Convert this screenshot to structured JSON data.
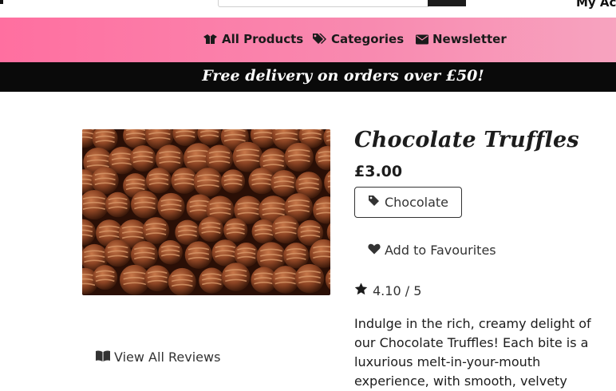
{
  "header": {
    "account_label": "My Ac"
  },
  "nav": {
    "items": [
      {
        "label": "All Products",
        "icon": "box-open-icon"
      },
      {
        "label": "Categories",
        "icon": "tags-icon"
      },
      {
        "label": "Newsletter",
        "icon": "envelope-icon"
      }
    ],
    "gradient_start": "#ff6fa0",
    "gradient_end": "#f7a3bf"
  },
  "banner": {
    "text": "Free delivery on orders over £50!"
  },
  "product": {
    "title": "Chocolate Truffles",
    "price": "£3.00",
    "category": "Chocolate",
    "favourite_label": "Add to Favourites",
    "rating": "4.10 / 5",
    "description": "Indulge in the rich, creamy delight of our Chocolate Truffles! Each bite is a luxurious melt-in-your-mouth experience, with smooth, velvety",
    "reviews_label": "View All Reviews"
  }
}
